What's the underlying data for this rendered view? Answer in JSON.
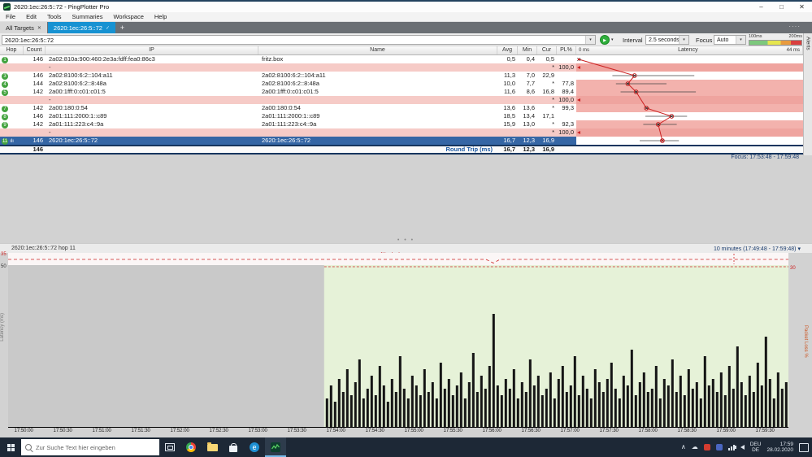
{
  "titlebar": {
    "title": "2620:1ec:26:5::72 - PingPlotter Pro"
  },
  "menubar": {
    "items": [
      "File",
      "Edit",
      "Tools",
      "Summaries",
      "Workspace",
      "Help"
    ]
  },
  "tabs": {
    "all_targets": "All Targets",
    "target": "2620:1ec:26:5::72"
  },
  "toolbar": {
    "target_value": "2620:1ec:26:5::72",
    "interval_label": "Interval",
    "interval_value": "2.5 seconds",
    "focus_label": "Focus",
    "focus_value": "Auto",
    "scale_label_1": "100ms",
    "scale_label_2": "200ms",
    "alerts_tab": "Alerts"
  },
  "table": {
    "headers": {
      "hop": "Hop",
      "count": "Count",
      "ip": "IP",
      "name": "Name",
      "avg": "Avg",
      "min": "Min",
      "cur": "Cur",
      "pl": "PL%",
      "latency": "Latency",
      "scale_left": "0 ms",
      "scale_right": "44 ms"
    },
    "rows": [
      {
        "hop": "1",
        "count": "146",
        "ip": "2a02:810a:900:460:2e3a:fdff:fea0:86c3",
        "name": "fritz.box",
        "avg": "0,5",
        "min": "0,4",
        "cur": "0,5",
        "pl": "",
        "style": "normal",
        "plot": {
          "avg": 0.5,
          "min": 0.4,
          "max": 0.9,
          "circle": false,
          "dot": true
        }
      },
      {
        "hop": "",
        "count": "",
        "ip": "-",
        "name": "",
        "avg": "",
        "min": "",
        "cur": "*",
        "pl": "100,0",
        "style": "loss-full",
        "plot": null
      },
      {
        "hop": "3",
        "count": "146",
        "ip": "2a02:8100:6:2::104:a11",
        "name": "2a02:8100:6:2::104:a11",
        "avg": "11,3",
        "min": "7,0",
        "cur": "22,9",
        "pl": "",
        "style": "normal",
        "plot": {
          "avg": 11.3,
          "min": 7.0,
          "max": 22.9,
          "circle": true,
          "dot": false
        }
      },
      {
        "hop": "4",
        "count": "144",
        "ip": "2a02:8100:6:2::8:48a",
        "name": "2a02:8100:6:2::8:48a",
        "avg": "10,0",
        "min": "7,7",
        "cur": "*",
        "pl": "77,8",
        "style": "loss-partial",
        "plot": {
          "avg": 10.0,
          "min": 7.7,
          "max": 17.5,
          "circle": true,
          "dot": false
        }
      },
      {
        "hop": "5",
        "count": "142",
        "ip": "2a00:1fff:0:c01:c01:5",
        "name": "2a00:1fff:0:c01:c01:5",
        "avg": "11,6",
        "min": "8,6",
        "cur": "16,8",
        "pl": "89,4",
        "style": "loss-partial",
        "plot": {
          "avg": 11.6,
          "min": 8.6,
          "max": 23.2,
          "circle": true,
          "dot": false
        }
      },
      {
        "hop": "",
        "count": "",
        "ip": "-",
        "name": "",
        "avg": "",
        "min": "",
        "cur": "*",
        "pl": "100,0",
        "style": "loss-full",
        "plot": null
      },
      {
        "hop": "7",
        "count": "142",
        "ip": "2a00:180:0:54",
        "name": "2a00:180:0:54",
        "avg": "13,6",
        "min": "13,6",
        "cur": "*",
        "pl": "99,3",
        "style": "loss-partial",
        "plot": {
          "avg": 13.6,
          "min": 13.6,
          "max": 14.2,
          "circle": true,
          "dot": false
        }
      },
      {
        "hop": "8",
        "count": "146",
        "ip": "2a01:111:2000:1::c89",
        "name": "2a01:111:2000:1::c89",
        "avg": "18,5",
        "min": "13,4",
        "cur": "17,1",
        "pl": "",
        "style": "normal",
        "plot": {
          "avg": 18.5,
          "min": 13.4,
          "max": 21.5,
          "circle": true,
          "dot": false
        }
      },
      {
        "hop": "9",
        "count": "142",
        "ip": "2a01:111:223:c4::9a",
        "name": "2a01:111:223:c4::9a",
        "avg": "15,9",
        "min": "13,0",
        "cur": "*",
        "pl": "92,3",
        "style": "loss-partial",
        "plot": {
          "avg": 15.9,
          "min": 13.0,
          "max": 19.5,
          "circle": true,
          "dot": false
        }
      },
      {
        "hop": "",
        "count": "",
        "ip": "-",
        "name": "",
        "avg": "",
        "min": "",
        "cur": "*",
        "pl": "100,0",
        "style": "loss-full",
        "plot": null
      },
      {
        "hop": "11",
        "count": "146",
        "ip": "2620:1ec:26:5::72",
        "name": "2620:1ec:26:5::72",
        "avg": "16,7",
        "min": "12,3",
        "cur": "16,9",
        "pl": "",
        "style": "selected",
        "chart_icon": true,
        "plot": {
          "avg": 16.7,
          "min": 12.3,
          "max": 19.9,
          "circle": true,
          "dot": true
        }
      }
    ],
    "round_trip": {
      "count": "146",
      "label": "Round Trip (ms)",
      "avg": "16,7",
      "min": "12,3",
      "cur": "16,9"
    },
    "focus_text": "Focus: 17:53:48 - 17:59:48"
  },
  "timeline": {
    "title": "2620:1ec:26:5::72 hop 11",
    "range": "10 minutes (17:49:48 - 17:59:48)",
    "jitter_label": "Jitter (ms)",
    "jitter_max": "35",
    "latency_max": "50",
    "loss_max": "30",
    "left_axis": "Latency (ms)",
    "right_axis": "Packet Loss %",
    "focus_start_frac": 0.405,
    "latency_scale_max_ms": 50,
    "ticks": [
      "17:50:00",
      "17:50:30",
      "17:51:00",
      "17:51:30",
      "17:52:00",
      "17:52:30",
      "17:53:00",
      "17:53:30",
      "17:54:00",
      "17:54:30",
      "17:55:00",
      "17:55:30",
      "17:56:00",
      "17:56:30",
      "17:57:00",
      "17:57:30",
      "17:58:00",
      "17:58:30",
      "17:59:00",
      "17:59:30"
    ],
    "bars": [
      9,
      13,
      8,
      15,
      11,
      18,
      10,
      14,
      21,
      9,
      12,
      16,
      10,
      19,
      13,
      8,
      15,
      11,
      22,
      12,
      9,
      16,
      13,
      10,
      18,
      11,
      14,
      9,
      20,
      12,
      15,
      10,
      13,
      17,
      9,
      14,
      23,
      11,
      16,
      12,
      19,
      35,
      13,
      10,
      15,
      12,
      18,
      9,
      14,
      11,
      21,
      13,
      16,
      10,
      12,
      17,
      9,
      15,
      19,
      11,
      13,
      22,
      10,
      16,
      12,
      9,
      18,
      14,
      11,
      15,
      20,
      12,
      9,
      16,
      13,
      24,
      10,
      14,
      17,
      11,
      12,
      19,
      9,
      15,
      13,
      21,
      11,
      16,
      10,
      18,
      12,
      14,
      9,
      22,
      13,
      15,
      11,
      17,
      10,
      19,
      12,
      25,
      14,
      10,
      16,
      11,
      20,
      13,
      28,
      15,
      9,
      17,
      12,
      14
    ]
  },
  "taskbar": {
    "search_placeholder": "Zur Suche Text hier eingeben",
    "lang_line1": "DEU",
    "lang_line2": "DE",
    "time": "17:59",
    "date": "28.02.2020"
  },
  "icons": {
    "close": "✕",
    "check": "✓",
    "dropdown": "▾",
    "play": "▶",
    "add": "+",
    "overflow": "····",
    "minimize": "–",
    "maximize": "□",
    "window_close": "✕",
    "splitter": "• • •",
    "mini_graph": "ılı",
    "chevron_up": "∧",
    "cloud": "☁",
    "edge_letter": "e"
  },
  "colors": {
    "active_tab": "#1792d2",
    "selected_row": "#3566a5",
    "loss_row": "#f0a9a4",
    "trace_red": "#cc2222",
    "timeline_green": "#e6f2d8",
    "taskbar": "#1d2836"
  }
}
